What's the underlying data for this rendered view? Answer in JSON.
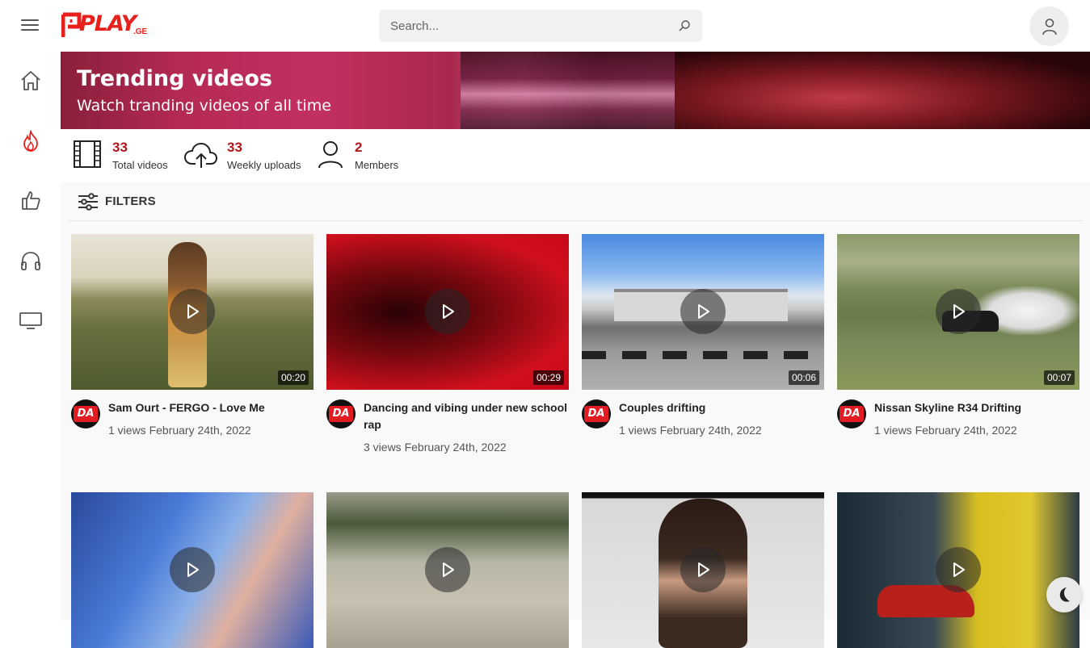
{
  "header": {
    "logo_text": "PLAY",
    "logo_suffix": ".GE",
    "search_placeholder": "Search..."
  },
  "sidebar": {
    "items": [
      {
        "name": "home",
        "icon": "home-icon"
      },
      {
        "name": "trending",
        "icon": "fire-icon",
        "active": true
      },
      {
        "name": "liked",
        "icon": "thumbs-up-icon"
      },
      {
        "name": "music",
        "icon": "headphones-icon"
      },
      {
        "name": "tv",
        "icon": "monitor-icon"
      }
    ]
  },
  "banner": {
    "title": "Trending videos",
    "subtitle": "Watch tranding videos of all time"
  },
  "stats": [
    {
      "value": "33",
      "label": "Total videos",
      "icon": "film-icon"
    },
    {
      "value": "33",
      "label": "Weekly uploads",
      "icon": "cloud-upload-icon"
    },
    {
      "value": "2",
      "label": "Members",
      "icon": "user-icon"
    }
  ],
  "filters": {
    "label": "FILTERS"
  },
  "videos": [
    {
      "title": "Sam Ourt - FERGO - Love Me",
      "duration": "00:20",
      "info": "1 views February 24th, 2022",
      "avatar": "DA"
    },
    {
      "title": "Dancing and vibing under new school rap",
      "duration": "00:29",
      "info": "3 views February 24th, 2022",
      "avatar": "DA"
    },
    {
      "title": "Couples drifting",
      "duration": "00:06",
      "info": "1 views February 24th, 2022",
      "avatar": "DA"
    },
    {
      "title": "Nissan Skyline R34 Drifting",
      "duration": "00:07",
      "info": "1 views February 24th, 2022",
      "avatar": "DA"
    },
    {
      "title": "",
      "duration": "",
      "info": "",
      "avatar": ""
    },
    {
      "title": "",
      "duration": "",
      "info": "",
      "avatar": ""
    },
    {
      "title": "",
      "duration": "",
      "info": "",
      "avatar": ""
    },
    {
      "title": "",
      "duration": "",
      "info": "",
      "avatar": ""
    }
  ],
  "colors": {
    "accent": "#b0171b",
    "brand": "#e8201c"
  }
}
